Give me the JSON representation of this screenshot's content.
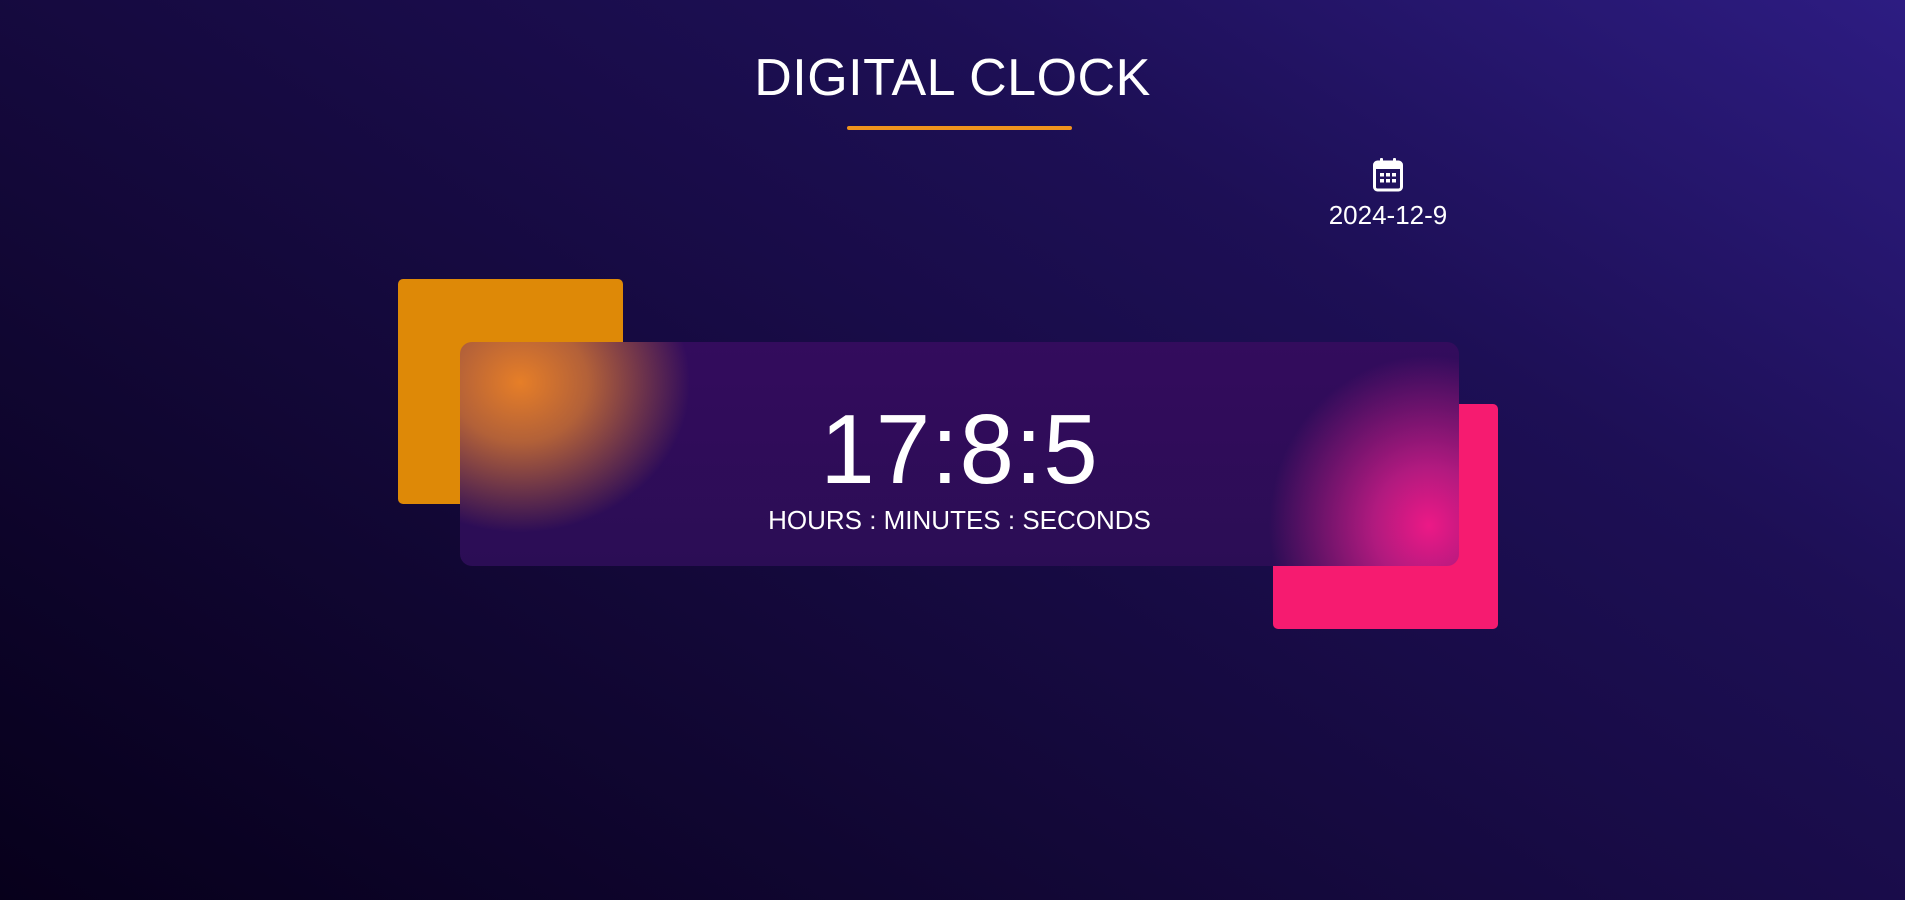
{
  "page": {
    "title": "DIGITAL CLOCK",
    "accent_color": "#f0931d"
  },
  "date_widget": {
    "icon": "calendar-icon",
    "date": "2024-12-9"
  },
  "clock": {
    "time": "17:8:5",
    "hours": 17,
    "minutes": 8,
    "seconds": 5,
    "units_label": "HOURS : MINUTES : SECONDS"
  },
  "colors": {
    "background_dark": "#07001b",
    "background_light": "#2d1c82",
    "orange_square": "#de8907",
    "pink_square": "#f61b70",
    "card_base": "#330c5d"
  }
}
